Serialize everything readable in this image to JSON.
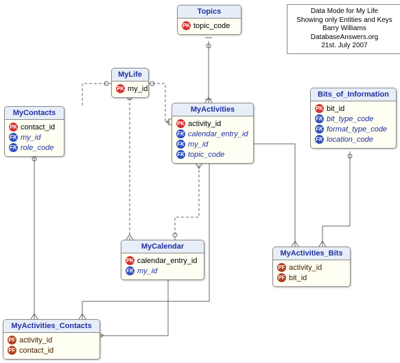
{
  "info": {
    "l1": "Data Mode for My Life",
    "l2": "Showing only Entities and Keys",
    "l3": "Barry Williams",
    "l4": "DatabaseAnswers.org",
    "l5": "21st. July 2007"
  },
  "entities": {
    "topics": {
      "title": "Topics",
      "attrs": [
        {
          "label": "topic_code",
          "key": "PK",
          "style": "pk"
        }
      ]
    },
    "mylife": {
      "title": "MyLife",
      "attrs": [
        {
          "label": "my_id",
          "key": "PK",
          "style": "pk"
        }
      ]
    },
    "mycontacts": {
      "title": "MyContacts",
      "attrs": [
        {
          "label": "contact_id",
          "key": "PK",
          "style": "pk"
        },
        {
          "label": "my_id",
          "key": "FK",
          "style": "fk"
        },
        {
          "label": "role_code",
          "key": "FK",
          "style": "fk"
        }
      ]
    },
    "bits": {
      "title": "Bits_of_Information",
      "attrs": [
        {
          "label": "bit_id",
          "key": "PK",
          "style": "pk"
        },
        {
          "label": "bit_type_code",
          "key": "FK",
          "style": "fk"
        },
        {
          "label": "format_type_code",
          "key": "FK",
          "style": "fk"
        },
        {
          "label": "location_code",
          "key": "FK",
          "style": "fk"
        }
      ]
    },
    "myactivities": {
      "title": "MyActivities",
      "attrs": [
        {
          "label": "activity_id",
          "key": "PK",
          "style": "pk"
        },
        {
          "label": "calendar_entry_id",
          "key": "FK",
          "style": "fk"
        },
        {
          "label": "my_id",
          "key": "FK",
          "style": "fk"
        },
        {
          "label": "topic_code",
          "key": "FK",
          "style": "fk"
        }
      ]
    },
    "mycalendar": {
      "title": "MyCalendar",
      "attrs": [
        {
          "label": "calendar_entry_id",
          "key": "PK",
          "style": "pk"
        },
        {
          "label": "my_id",
          "key": "FK",
          "style": "fk"
        }
      ]
    },
    "myactivities_bits": {
      "title": "MyActivities_Bits",
      "attrs": [
        {
          "label": "activity_id",
          "key": "PF",
          "style": "pf"
        },
        {
          "label": "bit_id",
          "key": "PF",
          "style": "pf"
        }
      ]
    },
    "myactivities_contacts": {
      "title": "MyActivities_Contacts",
      "attrs": [
        {
          "label": "activity_id",
          "key": "PF",
          "style": "pf"
        },
        {
          "label": "contact_id",
          "key": "PF",
          "style": "pf"
        }
      ]
    }
  },
  "relationships": [
    {
      "from": "Topics",
      "to": "MyActivities",
      "via": "topic_code"
    },
    {
      "from": "MyLife",
      "to": "MyActivities",
      "via": "my_id"
    },
    {
      "from": "MyLife",
      "to": "MyContacts",
      "via": "my_id"
    },
    {
      "from": "MyLife",
      "to": "MyCalendar",
      "via": "my_id"
    },
    {
      "from": "MyCalendar",
      "to": "MyActivities",
      "via": "calendar_entry_id"
    },
    {
      "from": "MyActivities",
      "to": "MyActivities_Bits",
      "via": "activity_id"
    },
    {
      "from": "Bits_of_Information",
      "to": "MyActivities_Bits",
      "via": "bit_id"
    },
    {
      "from": "MyActivities",
      "to": "MyActivities_Contacts",
      "via": "activity_id"
    },
    {
      "from": "MyContacts",
      "to": "MyActivities_Contacts",
      "via": "contact_id"
    },
    {
      "from": "MyCalendar",
      "to": "MyActivities_Contacts",
      "via": "calendar_entry_id"
    }
  ]
}
